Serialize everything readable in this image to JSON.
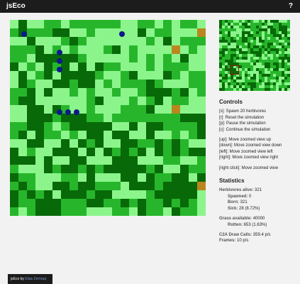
{
  "app": {
    "title": "jsEco",
    "help_label": "?"
  },
  "colors": {
    "grass_light": "#8bf58b",
    "grass_mid": "#27b62b",
    "grass_dark": "#086908",
    "rotten": "#b9871d",
    "herbivore": "#0c1a8a"
  },
  "controls": {
    "heading": "Controls",
    "lines": [
      "[s]: Spawn 20 herbivores",
      "[r]: Reset the simulation",
      "[p]: Pause the simulation",
      "[c]: Continue the simulation",
      "[up]: Move zoomed view up",
      "[down]: Move zoomed view down",
      "[left]: Move zoomed view left",
      "[right]: Move zoomed view right",
      "[right click]: Move zoomed view"
    ]
  },
  "stats": {
    "heading": "Statistics",
    "herbivores_alive_label": "Herbivores alive:",
    "herbivores_alive": "321",
    "spawned_label": "Spawned:",
    "spawned": "0",
    "born_label": "Born:",
    "born": "321",
    "sick_label": "Sick:",
    "sick": "28 (8.72%)",
    "grass_label": "Grass available:",
    "grass": "40000",
    "rotten_label": "Rotten:",
    "rotten": "653 (1.63%)",
    "draw_label": "C2A Draw Calls:",
    "draw": "359.4 p/s",
    "frames_label": "Frames:",
    "frames": "10 p/s"
  },
  "footer": {
    "prefix": "jsEco by",
    "author": "Elias Zerrouq"
  }
}
